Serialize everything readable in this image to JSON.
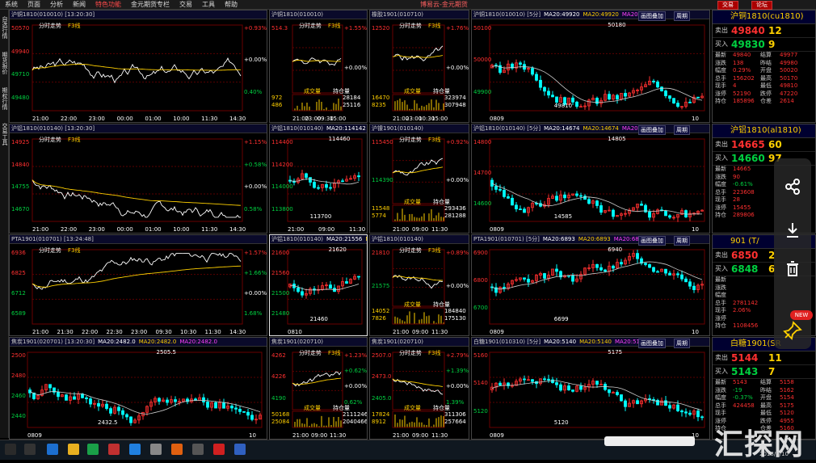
{
  "menu": [
    "系统",
    "页面",
    "分析",
    "新闻",
    "特色功能",
    "金元期货专栏",
    "交易",
    "工具",
    "帮助"
  ],
  "title": "博易云-金元期货",
  "top_buttons": [
    "交易",
    "论坛"
  ],
  "side_tabs": [
    "自选行情",
    "期货报价",
    "期权行情",
    "交易工具"
  ],
  "panes": [
    {
      "id": "cu1",
      "head": "沪铜1810(010010)  [13:20:30]",
      "tag": "分时走势",
      "tag2": "F3线",
      "y_left": [
        "50570",
        "49940",
        "49710",
        "49480"
      ],
      "y_right": [
        "+0.93%",
        "+0.00%",
        "0.40%"
      ],
      "x": [
        "21:00",
        "22:00",
        "23:00",
        "00:00",
        "01:00",
        "10:00",
        "11:30",
        "14:30"
      ]
    },
    {
      "id": "cu2",
      "head": "沪铜1810(010010)",
      "tag": "分时走势",
      "tag2": "F3线",
      "y_left": [
        "514.3"
      ],
      "y_right": [
        "+1.55%",
        "+0.00%"
      ],
      "vol": [
        "成交量",
        "持仓量"
      ],
      "vol_vals": [
        "972",
        "486",
        "28184",
        "25116"
      ],
      "x": [
        "21:00",
        "23:00",
        "09:30",
        "15:00"
      ]
    },
    {
      "id": "cu3",
      "head": "橡胶1901(010710)",
      "tag": "分时走势",
      "tag2": "F3线",
      "y_left": [
        "12520"
      ],
      "y_right": [
        "+1.76%",
        "+0.00%"
      ],
      "vol": [
        "成交量",
        "持仓量"
      ],
      "vol_vals": [
        "16470",
        "8235",
        "323974",
        "307948"
      ],
      "x": [
        "21:00",
        "23:00",
        "10:30",
        "15:00"
      ]
    },
    {
      "id": "cu4",
      "head": "沪铜1810(010010) [5分]",
      "ma": [
        "MA20:49920",
        "MA20:49920",
        "MA20:49920"
      ],
      "hi": "50180",
      "lo": "49810",
      "y": [
        "50100",
        "50000",
        "49900"
      ],
      "x": [
        "0809",
        "10"
      ],
      "btns": [
        "画图叠加",
        "周期"
      ]
    },
    {
      "id": "al1",
      "head": "沪铝1810(010140)  [13:20:30]",
      "tag": "分时走势",
      "tag2": "F3线",
      "y_left": [
        "14925",
        "14840",
        "14755",
        "14670"
      ],
      "y_right": [
        "+1.15%",
        "+0.58%",
        "+0.00%",
        "0.58%"
      ],
      "x": [
        "21:00",
        "22:00",
        "23:00",
        "00:00",
        "01:00",
        "10:00",
        "11:30",
        "14:30"
      ]
    },
    {
      "id": "al2",
      "head": "沪铝1810(010140)",
      "ma": [
        "MA20:114142",
        "MA20:114142"
      ],
      "hi": "114460",
      "lo": "113700",
      "y": [
        "114400",
        "114200",
        "114000",
        "113800"
      ],
      "x": [
        "21:00",
        "09:00",
        "11:30"
      ]
    },
    {
      "id": "al3",
      "head": "沪镍1901(010140)",
      "tag": "分时走势",
      "tag2": "F3线",
      "y_left": [
        "115450",
        "114390"
      ],
      "y_right": [
        "+0.92%",
        "+0.00%"
      ],
      "vol": [
        "成交量",
        "持仓量"
      ],
      "vol_vals": [
        "11548",
        "5774",
        "293436",
        "281288"
      ],
      "x": [
        "21:00",
        "09:00",
        "11:30"
      ]
    },
    {
      "id": "al4",
      "head": "沪铝1810(010140) [5分]",
      "ma": [
        "MA20:14674",
        "MA20:14674",
        "MA20:14674"
      ],
      "hi": "14805",
      "lo": "14585",
      "y": [
        "14800",
        "14700",
        "14600"
      ],
      "x": [
        "0809",
        "10"
      ],
      "btns": [
        "画图叠加",
        "周期"
      ]
    },
    {
      "id": "ta1",
      "head": "PTA1901(010701)  [13:24:48]",
      "tag": "分时走势",
      "tag2": "F3线",
      "y_left": [
        "6936",
        "6825",
        "6712",
        "6589"
      ],
      "y_right": [
        "+1.57%",
        "+1.66%",
        "+0.00%",
        "1.68%"
      ],
      "x": [
        "21:00",
        "21:30",
        "22:00",
        "22:30",
        "23:00",
        "09:30",
        "10:30",
        "11:30",
        "14:30"
      ]
    },
    {
      "id": "ta2",
      "head": "沪铝1810(010140)",
      "ma": [
        "MA20:21556",
        "MA20:21556"
      ],
      "hi": "21620",
      "lo": "21460",
      "y": [
        "21600",
        "21560",
        "21500",
        "21480"
      ],
      "x": [
        "0810"
      ]
    },
    {
      "id": "ta3",
      "head": "沪铝1810(010140)",
      "tag": "分时走势",
      "tag2": "F3线",
      "y_left": [
        "21810",
        "21575"
      ],
      "y_right": [
        "+0.89%",
        "+0.00%"
      ],
      "vol": [
        "成交量",
        "持仓量"
      ],
      "vol_vals": [
        "14052",
        "7826",
        "184840",
        "175130"
      ],
      "x": [
        "21:00",
        "09:00",
        "11:30"
      ]
    },
    {
      "id": "ta4",
      "head": "PTA1901(010701) [5分]",
      "ma": [
        "MA20:6893",
        "MA20:6893",
        "MA20:6893"
      ],
      "hi": "6940",
      "lo": "6699",
      "y": [
        "6900",
        "6800",
        "6700"
      ],
      "x": [
        "0809",
        "10"
      ],
      "btns": [
        "画图叠加",
        "周期"
      ]
    },
    {
      "id": "zn1",
      "head": "焦炭1901(020701)  [13:20:30]",
      "ma": [
        "MA20:2482.0",
        "MA20:2482.0",
        "MA20:2482.0"
      ],
      "hi": "2505.5",
      "lo": "2432.5",
      "y": [
        "2500",
        "2480",
        "2460",
        "2440"
      ],
      "x": [
        "0809",
        "10"
      ]
    },
    {
      "id": "zn2",
      "head": "焦炭1901(020710)",
      "tag": "分时走势",
      "tag2": "F3线",
      "y_left": [
        "4262",
        "4226",
        "4190"
      ],
      "y_right": [
        "+1.23%",
        "+0.62%",
        "+0.00%",
        "0.62%"
      ],
      "vol": [
        "成交量",
        "持仓量"
      ],
      "vol_vals": [
        "50168",
        "25084",
        "2111246",
        "2040466"
      ],
      "x": [
        "21:00",
        "09:00",
        "11:30"
      ]
    },
    {
      "id": "zn3",
      "head": "焦炭1901(020710)",
      "tag": "分时走势",
      "tag2": "F3线",
      "y_left": [
        "2507.0",
        "2473.0",
        "2405.0"
      ],
      "y_right": [
        "+2.79%",
        "+1.39%",
        "+0.00%",
        "1.39%"
      ],
      "vol": [
        "成交量",
        "持仓量"
      ],
      "vol_vals": [
        "17824",
        "8912",
        "311306",
        "257664"
      ],
      "x": [
        "21:00",
        "09:00",
        "11:30"
      ]
    },
    {
      "id": "zn4",
      "head": "白糖1901(010310) [5分]",
      "ma": [
        "MA20:5140",
        "MA20:5140",
        "MA20:5140"
      ],
      "hi": "5175",
      "lo": "5120",
      "y": [
        "5160",
        "5140",
        "5120"
      ],
      "x": [
        "0809",
        "10"
      ],
      "btns": [
        "画图叠加",
        "周期"
      ]
    }
  ],
  "quotes": [
    {
      "title": "沪铜1810(cu1810)",
      "sell": [
        "卖出",
        "49840",
        "12"
      ],
      "buy": [
        "买入",
        "49830",
        "9"
      ],
      "rows": [
        [
          "最新",
          "49840",
          "结算",
          "49977"
        ],
        [
          "涨跌",
          "138",
          "昨结",
          "49980"
        ],
        [
          "幅度",
          "0.29%",
          "开盘",
          "50020"
        ],
        [
          "总手",
          "156202",
          "最高",
          "50170"
        ],
        [
          "现手",
          "4",
          "最低",
          "49810"
        ],
        [
          "涨停",
          "52190",
          "跌停",
          "47220"
        ],
        [
          "持仓",
          "185896",
          "仓差",
          "2614"
        ]
      ]
    },
    {
      "title": "沪铝1810(al1810)",
      "sell": [
        "卖出",
        "14665",
        "60"
      ],
      "buy": [
        "买入",
        "14660",
        "97"
      ],
      "rows": [
        [
          "最新",
          "14665",
          "",
          " "
        ],
        [
          "涨跌",
          "90",
          "",
          " "
        ],
        [
          "幅度",
          "-0.61%",
          "",
          " "
        ],
        [
          "总手",
          "223608",
          "",
          " "
        ],
        [
          "现手",
          "28",
          "",
          " "
        ],
        [
          "涨停",
          "15455",
          "",
          " "
        ],
        [
          "持仓",
          "289806",
          "",
          " "
        ]
      ]
    },
    {
      "title": "901 (T/",
      "sell": [
        "卖出",
        "6850",
        "2"
      ],
      "buy": [
        "买入",
        "6848",
        "6"
      ],
      "rows": [
        [
          "最新",
          "",
          "",
          " "
        ],
        [
          "涨跌",
          "",
          "",
          " "
        ],
        [
          "幅度",
          "",
          "",
          " "
        ],
        [
          "总手",
          "2781142",
          "",
          " "
        ],
        [
          "现手",
          "2.06%",
          "",
          " "
        ],
        [
          "涨停",
          "",
          "",
          " "
        ],
        [
          "持仓",
          "1108456",
          "",
          " "
        ]
      ]
    },
    {
      "title": "白糖1901(SR",
      "sell": [
        "卖出",
        "5144",
        "11"
      ],
      "buy": [
        "买入",
        "5143",
        "7"
      ],
      "rows": [
        [
          "最新",
          "5143",
          "结算",
          "5158"
        ],
        [
          "涨跌",
          "-19",
          "昨结",
          "5162"
        ],
        [
          "幅度",
          "-0.37%",
          "开盘",
          "5154"
        ],
        [
          "总手",
          "424458",
          "最高",
          "5175"
        ],
        [
          "现手",
          "",
          "最低",
          "5120"
        ],
        [
          "涨停",
          "",
          "跌停",
          "4955"
        ],
        [
          "持仓",
          "",
          "仓差",
          "5160"
        ]
      ]
    }
  ],
  "overlay": {
    "badge": "NEW"
  },
  "watermark": "汇探网",
  "watermark_date": "2018/8/10",
  "colors": {
    "up": "#ff3030",
    "down": "#00ffff",
    "avg": "#ffd000",
    "price": "#ffffff"
  }
}
